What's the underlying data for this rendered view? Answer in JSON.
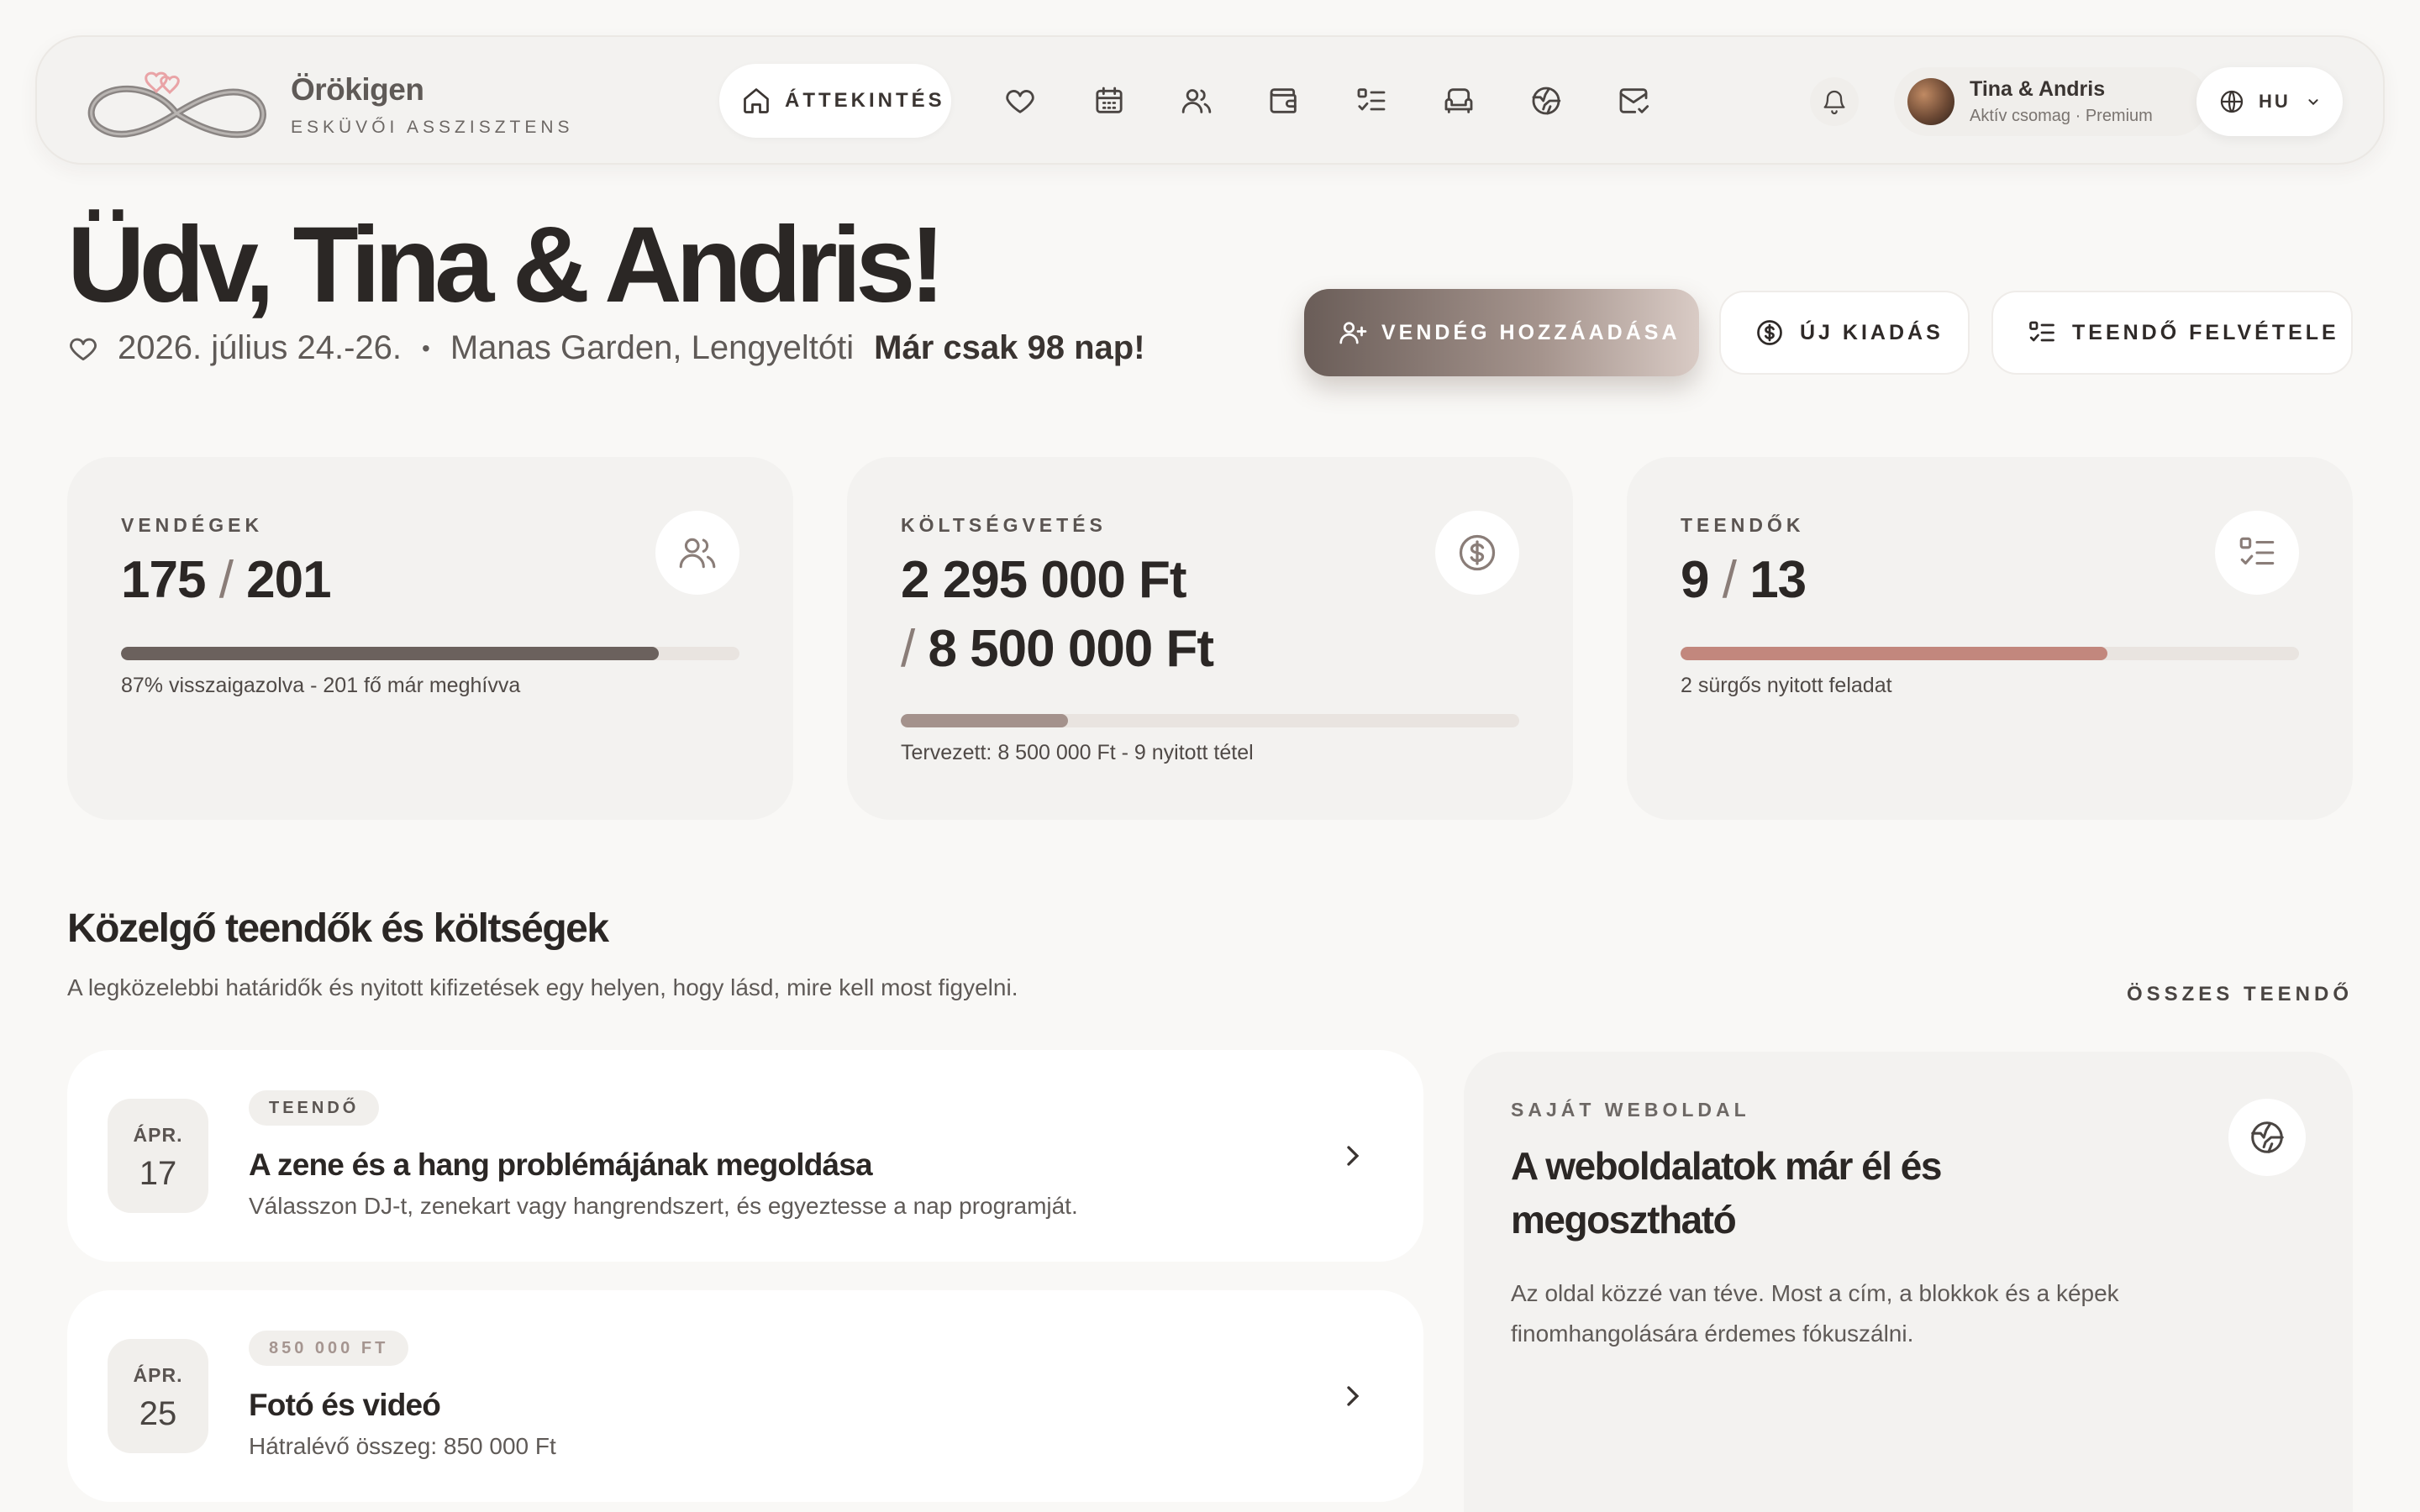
{
  "brand": {
    "name": "Örökigen",
    "subtitle": "ESKÜVŐI ASSZISZTENS"
  },
  "nav": {
    "active_label": "ÁTTEKINTÉS",
    "icons": [
      "home-icon",
      "heart-icon",
      "calendar-icon",
      "guests-icon",
      "wallet-icon",
      "checklist-icon",
      "sofa-icon",
      "globe-icon",
      "mail-icon"
    ]
  },
  "user": {
    "name": "Tina & Andris",
    "plan": "Aktív csomag · Premium"
  },
  "language": {
    "label": "HU"
  },
  "hero": {
    "title": "Üdv, Tina & Andris!",
    "date": "2026. július 24.-26.",
    "separator": "•",
    "venue": "Manas Garden, Lengyeltóti",
    "countdown": "Már csak 98 nap!"
  },
  "actions": {
    "add_guest": "VENDÉG HOZZÁADÁSA",
    "new_expense": "ÚJ KIADÁS",
    "add_task": "TEENDŐ FELVÉTELE"
  },
  "stats": {
    "guests": {
      "label": "VENDÉGEK",
      "value": "175",
      "total": "201",
      "note": "87% visszaigazolva - 201 fő már meghívva",
      "progress": 0.87
    },
    "budget": {
      "label": "KÖLTSÉGVETÉS",
      "value": "2 295 000 Ft",
      "total": "8 500 000 Ft",
      "note": "Tervezett: 8 500 000 Ft - 9 nyitott tétel",
      "progress": 0.27
    },
    "tasks": {
      "label": "TEENDŐK",
      "value": "9",
      "total": "13",
      "note": "2 sürgős nyitott feladat",
      "progress": 0.69
    }
  },
  "section": {
    "title": "Közelgő teendők és költségek",
    "subtitle": "A legközelebbi határidők és nyitott kifizetések egy helyen, hogy lásd, mire kell most figyelni.",
    "link": "ÖSSZES TEENDŐ"
  },
  "items": [
    {
      "month": "ÁPR.",
      "day": "17",
      "tag": "TEENDŐ",
      "title": "A zene és a hang problémájának megoldása",
      "desc": "Válasszon DJ-t, zenekart vagy hangrendszert, és egyeztesse a nap programját."
    },
    {
      "month": "ÁPR.",
      "day": "25",
      "tag": "850 000 FT",
      "title": "Fotó és videó",
      "desc": "Hátralévő összeg: 850 000 Ft"
    }
  ],
  "website": {
    "label": "SAJÁT WEBOLDAL",
    "title": "A weboldalatok már él és megosztható",
    "desc": "Az oldal közzé van téve. Most a cím, a blokkok és a képek finomhangolására érdemes fókuszálni."
  },
  "colors": {
    "accent": "#6a5d58",
    "guests_bar": "#6b615d",
    "budget_bar": "#a4928c",
    "tasks_bar": "#c2877d",
    "logo_heart": "#e9a3a6"
  }
}
